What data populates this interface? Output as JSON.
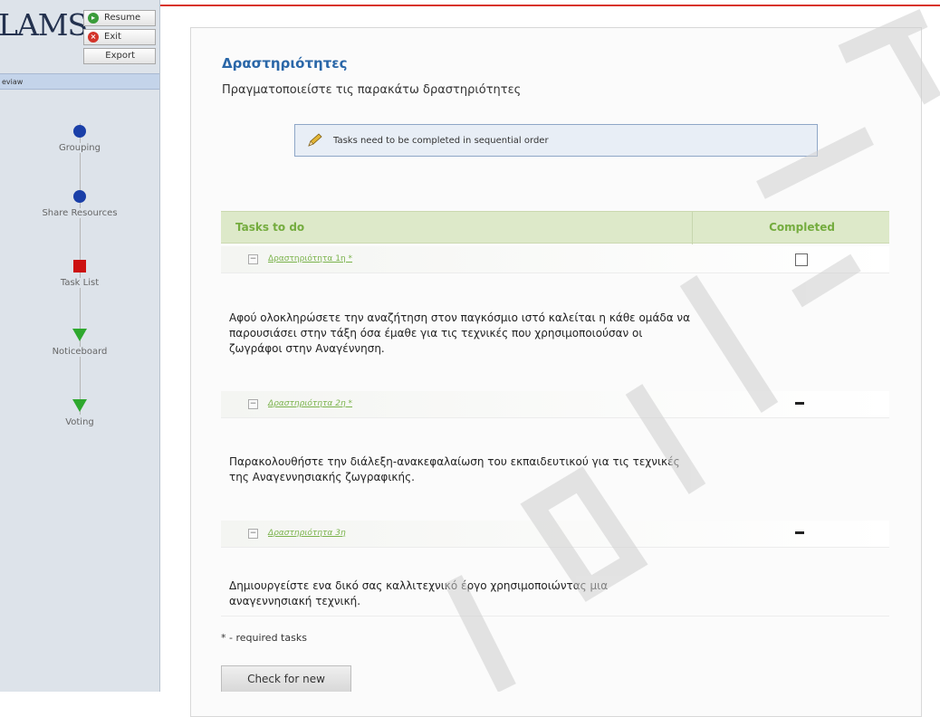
{
  "app": {
    "logo_text": "LAMS",
    "buttons": {
      "resume": "Resume",
      "exit": "Exit",
      "export": "Export"
    },
    "lesson_bar_label": "eviaw"
  },
  "sidebar": {
    "activities": [
      {
        "label": "Grouping",
        "shape": "dot",
        "color": "#1a3fa8"
      },
      {
        "label": "Share Resources",
        "shape": "dot",
        "color": "#1a3fa8"
      },
      {
        "label": "Task List",
        "shape": "square",
        "color": "#cc1111"
      },
      {
        "label": "Noticeboard",
        "shape": "triangle",
        "color": "#2ea82e"
      },
      {
        "label": "Voting",
        "shape": "triangle",
        "color": "#2ea82e"
      }
    ]
  },
  "main": {
    "title": "Δραστηριότητες",
    "subtitle": "Πραγματοποιείστε τις παρακάτω δραστηριότητες",
    "info_message": "Tasks need to be completed in sequential order",
    "table": {
      "col_tasks": "Tasks to do",
      "col_completed": "Completed",
      "tasks": [
        {
          "name": "Δραστηριότητα 1η *",
          "status": "checkbox",
          "description": "Αφού ολοκληρώσετε την αναζήτηση στον παγκόσμιο ιστό καλείται η κάθε ομάδα να παρουσιάσει στην τάξη όσα έμαθε για τις τεχνικές που χρησιμοποιούσαν οι ζωγράφοι στην Αναγέννηση."
        },
        {
          "name": "Δραστηριότητα 2η *",
          "status": "dash",
          "description": "Παρακολουθήστε την διάλεξη-ανακεφαλαίωση του εκπαιδευτικού για τις τεχνικές της Αναγεννησιακής ζωγραφικής."
        },
        {
          "name": "Δραστηριότητα 3η",
          "status": "dash",
          "description": "Δημιουργείστε ενα δικό σας καλλιτεχνικό έργο χρησιμοποιώντας μια αναγεννησιακή τεχνική."
        }
      ]
    },
    "required_note": "* - required tasks",
    "check_button": "Check for new"
  },
  "colors": {
    "title": "#2a67a8",
    "header_bg": "#dde9c9",
    "header_text": "#74ac3e",
    "watermark": "#c9c9c9"
  }
}
